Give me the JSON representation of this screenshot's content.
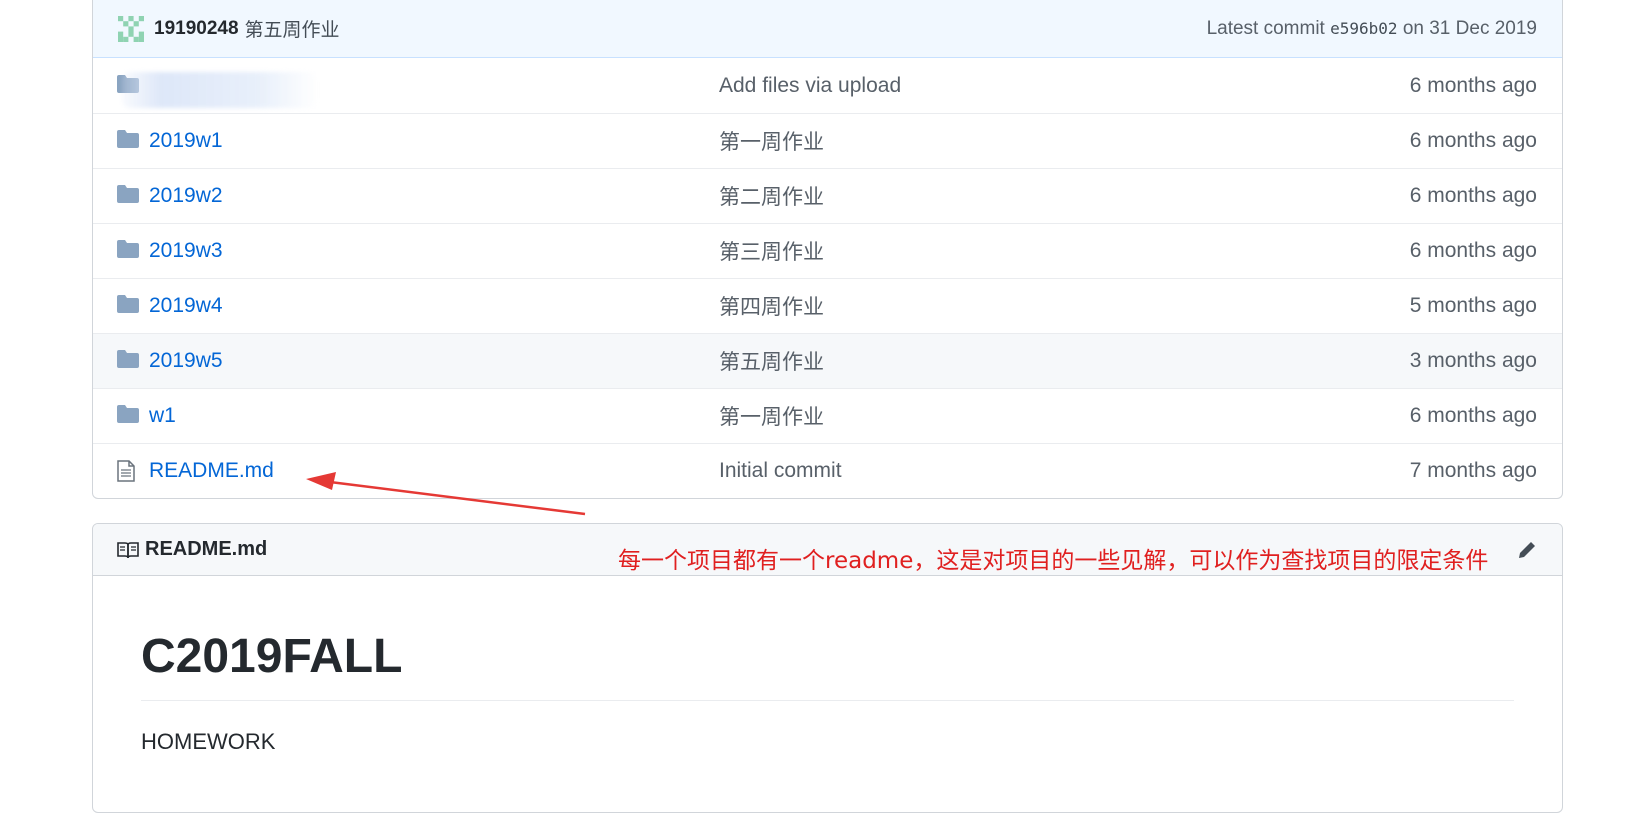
{
  "commit_bar": {
    "user": "19190248",
    "message": "第五周作业",
    "latest_prefix": "Latest commit",
    "sha": "e596b02",
    "date_text": "on 31 Dec 2019"
  },
  "files": [
    {
      "name": "",
      "type": "folder",
      "message": "Add files via upload",
      "age": "6 months ago",
      "highlight": false,
      "blurred": true
    },
    {
      "name": "2019w1",
      "type": "folder",
      "message": "第一周作业",
      "age": "6 months ago",
      "highlight": false
    },
    {
      "name": "2019w2",
      "type": "folder",
      "message": "第二周作业",
      "age": "6 months ago",
      "highlight": false
    },
    {
      "name": "2019w3",
      "type": "folder",
      "message": "第三周作业",
      "age": "6 months ago",
      "highlight": false
    },
    {
      "name": "2019w4",
      "type": "folder",
      "message": "第四周作业",
      "age": "5 months ago",
      "highlight": false
    },
    {
      "name": "2019w5",
      "type": "folder",
      "message": "第五周作业",
      "age": "3 months ago",
      "highlight": true
    },
    {
      "name": "w1",
      "type": "folder",
      "message": "第一周作业",
      "age": "6 months ago",
      "highlight": false
    },
    {
      "name": "README.md",
      "type": "file",
      "message": "Initial commit",
      "age": "7 months ago",
      "highlight": false
    }
  ],
  "readme": {
    "header": "README.md",
    "title": "C2019FALL",
    "body": "HOMEWORK"
  },
  "annotation": "每一个项目都有一个readme，这是对项目的一些见解，可以作为查找项目的限定条件",
  "colors": {
    "link": "#0366d6",
    "folder_icon": "#79b8ff",
    "annotation": "#e02020"
  }
}
